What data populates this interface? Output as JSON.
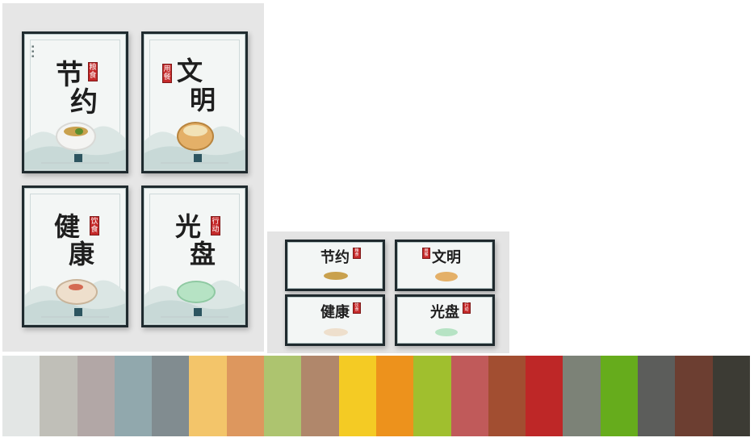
{
  "posters": [
    {
      "main": "节约",
      "char1": "节",
      "char2": "约",
      "seal": "粮食",
      "dish_color": "#f2f2f0",
      "accent": "#c9a14e"
    },
    {
      "main": "文明",
      "char1": "文",
      "char2": "明",
      "seal": "用餐",
      "dish_color": "#e4b068",
      "accent": "#e2c48c"
    },
    {
      "main": "健康",
      "char1": "健",
      "char2": "康",
      "seal": "饮食",
      "dish_color": "#eedfcc",
      "accent": "#d46a52"
    },
    {
      "main": "光盘",
      "char1": "光",
      "char2": "盘",
      "seal": "行动",
      "dish_color": "#b6e3c4",
      "accent": "#9ad3aa"
    }
  ],
  "palette": [
    "#e3e6e5",
    "#c0bfb8",
    "#b2a7a6",
    "#91a8ad",
    "#818c90",
    "#f3c56a",
    "#dd975e",
    "#adc46f",
    "#b0876b",
    "#f4cb24",
    "#ed921c",
    "#a0bf2e",
    "#c05a5a",
    "#a24e31",
    "#be2727",
    "#7c8277",
    "#66ac1c",
    "#5c5d5b",
    "#6c3e31",
    "#3c3b34"
  ]
}
